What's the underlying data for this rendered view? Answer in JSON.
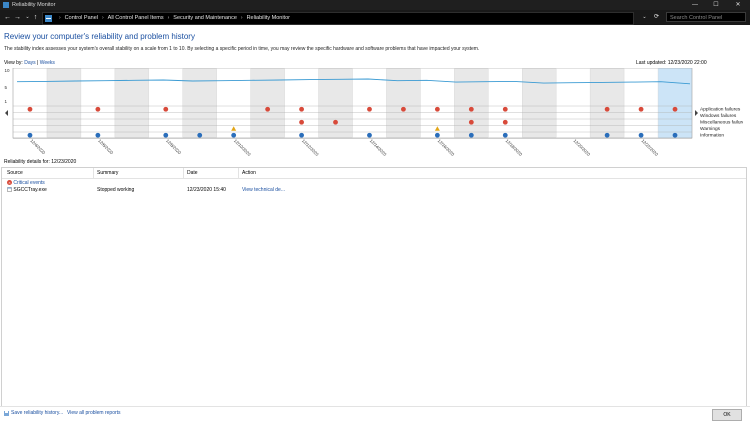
{
  "window": {
    "title": "Reliability Monitor",
    "min_glyph": "—",
    "max_glyph": "☐",
    "close_glyph": "✕"
  },
  "nav": {
    "back_glyph": "←",
    "forward_glyph": "→",
    "dropdown_glyph": "⌄",
    "up_glyph": "↑",
    "refresh_glyph": "⟳",
    "separator_glyph": "›"
  },
  "breadcrumb": [
    "Control Panel",
    "All Control Panel Items",
    "Security and Maintenance",
    "Reliability Monitor"
  ],
  "search": {
    "placeholder": "Search Control Panel"
  },
  "page": {
    "heading": "Review your computer's reliability and problem history",
    "description": "The stability index assesses your system's overall stability on a scale from 1 to 10. By selecting a specific period in time, you may review the specific hardware and software problems that have impacted your system.",
    "view_by_label": "View by:",
    "view_days": "Days",
    "view_sep": "|",
    "view_weeks": "Weeks",
    "last_updated": "Last updated: 12/23/2020 22:00"
  },
  "chart_data": {
    "type": "line",
    "y_ticks": [
      "10",
      "5",
      "1"
    ],
    "ylim": [
      1,
      10
    ],
    "dates": [
      "12/4/2020",
      "12/6/2020",
      "12/8/2020",
      "12/10/2020",
      "12/12/2020",
      "12/14/2020",
      "12/16/2020",
      "12/18/2020",
      "12/20/2020",
      "12/22/2020"
    ],
    "stability": [
      6.6,
      6.7,
      6.8,
      6.9,
      7.0,
      7.1,
      6.8,
      6.9,
      7.0,
      7.1,
      7.2,
      7.3,
      7.4,
      6.9,
      7.0,
      6.5,
      6.6,
      6.7,
      6.2,
      6.3,
      6.4,
      6.5,
      6.6,
      6.0
    ],
    "row_labels": [
      "Application failures",
      "Windows failures",
      "Miscellaneous failures",
      "Warnings",
      "Information"
    ],
    "events": [
      {
        "row": 0,
        "cols": [
          0,
          2,
          4,
          7,
          8,
          10,
          11,
          12,
          13,
          14,
          17,
          18,
          19
        ]
      },
      {
        "row": 2,
        "cols": [
          8,
          9,
          13,
          14
        ]
      },
      {
        "row": 3,
        "cols": [
          6,
          12
        ]
      },
      {
        "row": 4,
        "cols": [
          0,
          2,
          4,
          5,
          6,
          8,
          10,
          12,
          13,
          14,
          17,
          18,
          19
        ]
      }
    ],
    "selected_col": 19,
    "colors": {
      "line": "#3b9bd3",
      "error": "#d84a3a",
      "warning": "#e3a617",
      "info": "#2a6ebb",
      "selected": "#cce4f7",
      "alt_band": "#e8e8e8"
    }
  },
  "details": {
    "label": "Reliability details for: 12/23/2020",
    "columns": [
      "Source",
      "Summary",
      "Date",
      "Action"
    ],
    "group": "Critical events",
    "events": [
      {
        "source": "SGCCTray.exe",
        "summary": "Stopped working",
        "date": "12/23/2020 15:40",
        "action": "View technical de..."
      }
    ]
  },
  "footer": {
    "save_link": "Save reliability history...",
    "problems_link": "View all problem reports",
    "ok": "OK"
  }
}
